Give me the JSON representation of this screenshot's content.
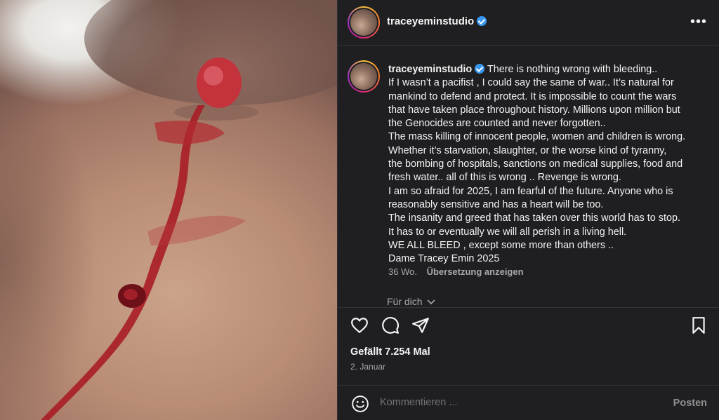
{
  "post": {
    "username": "traceyeminstudio",
    "caption_first": "There is nothing wrong with bleeding..",
    "caption_lines": [
      "If I wasn’t a pacifist , I could say the same of war.. It’s natural for",
      "mankind to defend and protect. It is impossible to count the wars",
      "that have taken place throughout history. Millions upon million but",
      "the Genocides are counted and never forgotten..",
      "The mass killing of innocent people, women and children is wrong.",
      "Whether it’s starvation, slaughter, or the worse kind of tyranny,",
      "the bombing of hospitals, sanctions on medical supplies, food and",
      "fresh water.. all of this is wrong .. Revenge is wrong.",
      "I am so afraid for 2025, I am fearful of the future. Anyone who is",
      "reasonably sensitive and has a heart will be too.",
      "The insanity and greed that has taken over this world has to stop.",
      "It has to or eventually we will all perish in a living hell.",
      "WE ALL BLEED , except some more than others ..",
      "Dame Tracey Emin 2025"
    ],
    "age": "36 Wo.",
    "translate_label": "Übersetzung anzeigen",
    "for_you_label": "Für dich",
    "likes": "Gefällt 7.254 Mal",
    "date": "2. Januar",
    "comment_placeholder": "Kommentieren ...",
    "post_label": "Posten",
    "more_label": "•••"
  },
  "icons": [
    "heart-icon",
    "comment-icon",
    "share-icon",
    "bookmark-icon",
    "emoji-icon",
    "verified-icon",
    "chevron-down-icon"
  ],
  "colors": {
    "background": "#1f1f22",
    "verified": "#3897f0",
    "muted": "#a8a8a8"
  }
}
